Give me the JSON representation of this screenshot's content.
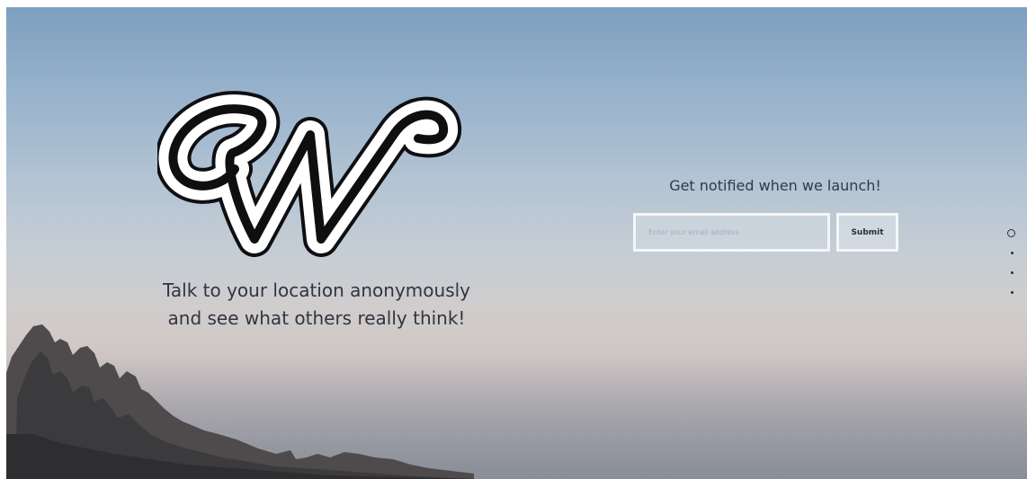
{
  "hero": {
    "tagline_line1": "Talk to your location anonymously",
    "tagline_line2": "and see what others really think!",
    "logo_icon": "w-script-logo"
  },
  "signup": {
    "heading": "Get notified when we launch!",
    "email_placeholder": "Enter your email address",
    "email_value": "",
    "submit_label": "Submit"
  },
  "pager": {
    "total_pages": 4,
    "active_page": 1
  },
  "colors": {
    "text_dark": "#2f3640",
    "field_border": "#f4f6f8",
    "sky_top": "#7d9fbf",
    "sky_horizon": "#d1cdcd"
  }
}
